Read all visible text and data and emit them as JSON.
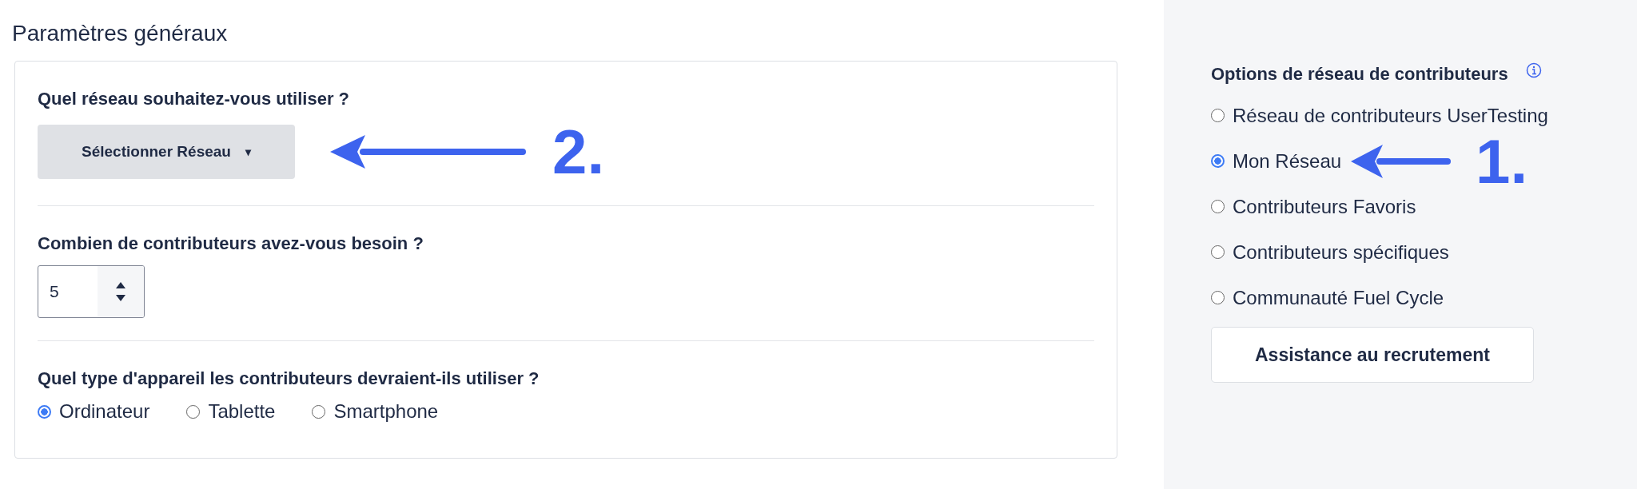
{
  "page_title": "Paramètres généraux",
  "network_question": {
    "label": "Quel réseau souhaitez-vous utiliser ?",
    "dropdown": "Sélectionner Réseau",
    "caret": "▾",
    "annotation": "2."
  },
  "count_question": {
    "label": "Combien de contributeurs avez-vous besoin ?",
    "value": "5"
  },
  "device_question": {
    "label": "Quel type d'appareil les contributeurs devraient-ils utiliser ?",
    "options": [
      {
        "label": "Ordinateur",
        "selected": true
      },
      {
        "label": "Tablette",
        "selected": false
      },
      {
        "label": "Smartphone",
        "selected": false
      }
    ]
  },
  "sidebar": {
    "heading": "Options de réseau de contributeurs",
    "options": [
      {
        "label": "Réseau de contributeurs UserTesting",
        "selected": false
      },
      {
        "label": "Mon Réseau",
        "selected": true,
        "annotation": "1."
      },
      {
        "label": "Contributeurs Favoris",
        "selected": false
      },
      {
        "label": "Contributeurs spécifiques",
        "selected": false
      },
      {
        "label": "Communauté Fuel Cycle",
        "selected": false
      }
    ],
    "button": "Assistance au recrutement"
  }
}
